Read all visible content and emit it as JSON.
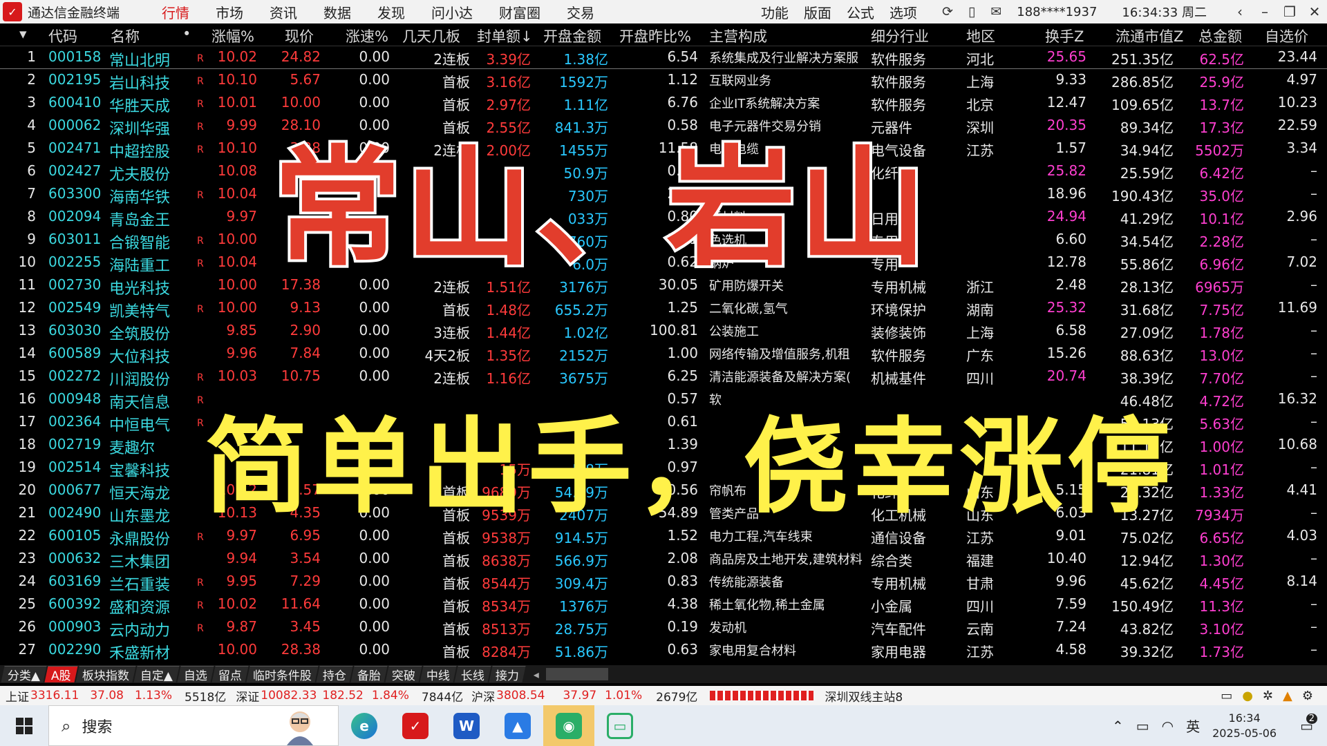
{
  "app": {
    "title": "通达信金融终端",
    "menu": [
      "行情",
      "市场",
      "资讯",
      "数据",
      "发现",
      "问小达",
      "财富圈",
      "交易"
    ],
    "active_menu": "行情",
    "right_menu": [
      "功能",
      "版面",
      "公式",
      "选项"
    ],
    "user": "188****1937",
    "clock": "16:34:33 周二"
  },
  "columns": [
    "代码",
    "名称",
    "涨幅%",
    "现价",
    "涨速%",
    "几天几板",
    "封单额↓",
    "开盘金额",
    "开盘昨比%",
    "主营构成",
    "细分行业",
    "地区",
    "换手Z",
    "流通市值Z",
    "总金额",
    "自选价"
  ],
  "rows": [
    {
      "n": "1",
      "code": "000158",
      "name": "常山北明",
      "f": "R",
      "chg": "10.02",
      "price": "24.82",
      "spd": "0.00",
      "board": "2连板",
      "seal": "3.39亿",
      "open": "1.38亿",
      "ratio": "6.54",
      "biz": "系统集成及行业解决方案服",
      "ind": "软件服务",
      "region": "河北",
      "turn": "25.65",
      "turn_hi": true,
      "mcap": "251.35亿",
      "amt": "62.5亿",
      "sel": "23.44"
    },
    {
      "n": "2",
      "code": "002195",
      "name": "岩山科技",
      "f": "R",
      "chg": "10.10",
      "price": "5.67",
      "spd": "0.00",
      "board": "首板",
      "seal": "3.16亿",
      "open": "1592万",
      "ratio": "1.12",
      "biz": "互联网业务",
      "ind": "软件服务",
      "region": "上海",
      "turn": "9.33",
      "turn_hi": false,
      "mcap": "286.85亿",
      "amt": "25.9亿",
      "sel": "4.97"
    },
    {
      "n": "3",
      "code": "600410",
      "name": "华胜天成",
      "f": "R",
      "chg": "10.01",
      "price": "10.00",
      "spd": "0.00",
      "board": "首板",
      "seal": "2.97亿",
      "open": "1.11亿",
      "ratio": "6.76",
      "biz": "企业IT系统解决方案",
      "ind": "软件服务",
      "region": "北京",
      "turn": "12.47",
      "turn_hi": false,
      "mcap": "109.65亿",
      "amt": "13.7亿",
      "sel": "10.23"
    },
    {
      "n": "4",
      "code": "000062",
      "name": "深圳华强",
      "f": "R",
      "chg": "9.99",
      "price": "28.10",
      "spd": "0.00",
      "board": "首板",
      "seal": "2.55亿",
      "open": "841.3万",
      "ratio": "0.58",
      "biz": "电子元器件交易分销",
      "ind": "元器件",
      "region": "深圳",
      "turn": "20.35",
      "turn_hi": true,
      "mcap": "89.34亿",
      "amt": "17.3亿",
      "sel": "22.59"
    },
    {
      "n": "5",
      "code": "002471",
      "name": "中超控股",
      "f": "R",
      "chg": "10.10",
      "price": "3.38",
      "spd": "0.00",
      "board": "2连板",
      "seal": "2.00亿",
      "open": "1455万",
      "ratio": "11.58",
      "biz": "电力电缆",
      "ind": "电气设备",
      "region": "江苏",
      "turn": "1.57",
      "turn_hi": false,
      "mcap": "34.94亿",
      "amt": "5502万",
      "sel": "3.34"
    },
    {
      "n": "6",
      "code": "002427",
      "name": "尤夫股份",
      "f": "",
      "chg": "10.08",
      "price": "",
      "spd": "",
      "board": "",
      "seal": "",
      "open": "50.9万",
      "ratio": "0.70",
      "biz": "涤纶工业丝",
      "ind": "化纤",
      "region": "",
      "turn": "25.82",
      "turn_hi": true,
      "mcap": "25.59亿",
      "amt": "6.42亿",
      "sel": "–"
    },
    {
      "n": "7",
      "code": "603300",
      "name": "海南华铁",
      "f": "R",
      "chg": "10.04",
      "price": "",
      "spd": "",
      "board": "",
      "seal": "",
      "open": "730万",
      "ratio": "2.36",
      "biz": "高空作业平台",
      "ind": "",
      "region": "",
      "turn": "18.96",
      "turn_hi": false,
      "mcap": "190.43亿",
      "amt": "35.0亿",
      "sel": "–"
    },
    {
      "n": "8",
      "code": "002094",
      "name": "青岛金王",
      "f": "",
      "chg": "9.97",
      "price": "",
      "spd": "",
      "board": "",
      "seal": "",
      "open": "033万",
      "ratio": "0.80",
      "biz": "新材料",
      "ind": "日用",
      "region": "",
      "turn": "24.94",
      "turn_hi": true,
      "mcap": "41.29亿",
      "amt": "10.1亿",
      "sel": "2.96"
    },
    {
      "n": "9",
      "code": "603011",
      "name": "合锻智能",
      "f": "R",
      "chg": "10.00",
      "price": "",
      "spd": "",
      "board": "",
      "seal": "",
      "open": "760万",
      "ratio": "3.61",
      "biz": "色选机",
      "ind": "专用",
      "region": "",
      "turn": "6.60",
      "turn_hi": false,
      "mcap": "34.54亿",
      "amt": "2.28亿",
      "sel": "–"
    },
    {
      "n": "10",
      "code": "002255",
      "name": "海陆重工",
      "f": "R",
      "chg": "10.04",
      "price": "",
      "spd": "",
      "board": "",
      "seal": "",
      "open": "6.0万",
      "ratio": "0.62",
      "biz": "锅炉",
      "ind": "专用",
      "region": "",
      "turn": "12.78",
      "turn_hi": false,
      "mcap": "55.86亿",
      "amt": "6.96亿",
      "sel": "7.02"
    },
    {
      "n": "11",
      "code": "002730",
      "name": "电光科技",
      "f": "",
      "chg": "10.00",
      "price": "17.38",
      "spd": "0.00",
      "board": "2连板",
      "seal": "1.51亿",
      "open": "3176万",
      "ratio": "30.05",
      "biz": "矿用防爆开关",
      "ind": "专用机械",
      "region": "浙江",
      "turn": "2.48",
      "turn_hi": false,
      "mcap": "28.13亿",
      "amt": "6965万",
      "sel": "–"
    },
    {
      "n": "12",
      "code": "002549",
      "name": "凯美特气",
      "f": "R",
      "chg": "10.00",
      "price": "9.13",
      "spd": "0.00",
      "board": "首板",
      "seal": "1.48亿",
      "open": "655.2万",
      "ratio": "1.25",
      "biz": "二氧化碳,氢气",
      "ind": "环境保护",
      "region": "湖南",
      "turn": "25.32",
      "turn_hi": true,
      "mcap": "31.68亿",
      "amt": "7.75亿",
      "sel": "11.69"
    },
    {
      "n": "13",
      "code": "603030",
      "name": "全筑股份",
      "f": "",
      "chg": "9.85",
      "price": "2.90",
      "spd": "0.00",
      "board": "3连板",
      "seal": "1.44亿",
      "open": "1.02亿",
      "ratio": "100.81",
      "biz": "公装施工",
      "ind": "装修装饰",
      "region": "上海",
      "turn": "6.58",
      "turn_hi": false,
      "mcap": "27.09亿",
      "amt": "1.78亿",
      "sel": "–"
    },
    {
      "n": "14",
      "code": "600589",
      "name": "大位科技",
      "f": "",
      "chg": "9.96",
      "price": "7.84",
      "spd": "0.00",
      "board": "4天2板",
      "seal": "1.35亿",
      "open": "2152万",
      "ratio": "1.00",
      "biz": "网络传输及增值服务,机租",
      "ind": "软件服务",
      "region": "广东",
      "turn": "15.26",
      "turn_hi": false,
      "mcap": "88.63亿",
      "amt": "13.0亿",
      "sel": "–"
    },
    {
      "n": "15",
      "code": "002272",
      "name": "川润股份",
      "f": "R",
      "chg": "10.03",
      "price": "10.75",
      "spd": "0.00",
      "board": "2连板",
      "seal": "1.16亿",
      "open": "3675万",
      "ratio": "6.25",
      "biz": "清洁能源装备及解决方案(",
      "ind": "机械基件",
      "region": "四川",
      "turn": "20.74",
      "turn_hi": true,
      "mcap": "38.39亿",
      "amt": "7.70亿",
      "sel": "–"
    },
    {
      "n": "16",
      "code": "000948",
      "name": "南天信息",
      "f": "R",
      "chg": "",
      "price": "",
      "spd": "",
      "board": "",
      "seal": "",
      "open": "",
      "ratio": "0.57",
      "biz": "软",
      "ind": "",
      "region": "",
      "turn": "",
      "turn_hi": false,
      "mcap": "46.48亿",
      "amt": "4.72亿",
      "sel": "16.32"
    },
    {
      "n": "17",
      "code": "002364",
      "name": "中恒电气",
      "f": "R",
      "chg": "",
      "price": "",
      "spd": "",
      "board": "",
      "seal": "",
      "open": "",
      "ratio": "0.61",
      "biz": "",
      "ind": "",
      "region": "",
      "turn": "",
      "turn_hi": false,
      "mcap": "51.13亿",
      "amt": "5.63亿",
      "sel": "–"
    },
    {
      "n": "18",
      "code": "002719",
      "name": "麦趣尔",
      "f": "",
      "chg": "",
      "price": "",
      "spd": "",
      "board": "",
      "seal": "",
      "open": "",
      "ratio": "1.39",
      "biz": "",
      "ind": "",
      "region": "",
      "turn": "",
      "turn_hi": false,
      "mcap": "11.12亿",
      "amt": "1.00亿",
      "sel": "10.68"
    },
    {
      "n": "19",
      "code": "002514",
      "name": "宝馨科技",
      "f": "",
      "chg": "",
      "price": "",
      "spd": "",
      "board": "",
      "seal": "15万",
      "open": "5.8万",
      "ratio": "0.97",
      "biz": "",
      "ind": "",
      "region": "",
      "turn": "",
      "turn_hi": false,
      "mcap": "21.81亿",
      "amt": "1.01亿",
      "sel": "–"
    },
    {
      "n": "20",
      "code": "000677",
      "name": "恒天海龙",
      "f": "",
      "chg": "10.12",
      "price": "4.57",
      "spd": "0.00",
      "board": "首板",
      "seal": "9689万",
      "open": "54.09万",
      "ratio": "0.56",
      "biz": "帘帆布",
      "ind": "化纤",
      "region": "山东",
      "turn": "5.15",
      "turn_hi": false,
      "mcap": "26.32亿",
      "amt": "1.33亿",
      "sel": "4.41"
    },
    {
      "n": "21",
      "code": "002490",
      "name": "山东墨龙",
      "f": "",
      "chg": "10.13",
      "price": "4.35",
      "spd": "0.00",
      "board": "首板",
      "seal": "9539万",
      "open": "2407万",
      "ratio": "54.89",
      "biz": "管类产品",
      "ind": "化工机械",
      "region": "山东",
      "turn": "6.03",
      "turn_hi": false,
      "mcap": "13.27亿",
      "amt": "7934万",
      "sel": "–"
    },
    {
      "n": "22",
      "code": "600105",
      "name": "永鼎股份",
      "f": "R",
      "chg": "9.97",
      "price": "6.95",
      "spd": "0.00",
      "board": "首板",
      "seal": "9538万",
      "open": "914.5万",
      "ratio": "1.52",
      "biz": "电力工程,汽车线束",
      "ind": "通信设备",
      "region": "江苏",
      "turn": "9.01",
      "turn_hi": false,
      "mcap": "75.02亿",
      "amt": "6.65亿",
      "sel": "4.03"
    },
    {
      "n": "23",
      "code": "000632",
      "name": "三木集团",
      "f": "",
      "chg": "9.94",
      "price": "3.54",
      "spd": "0.00",
      "board": "首板",
      "seal": "8638万",
      "open": "566.9万",
      "ratio": "2.08",
      "biz": "商品房及土地开发,建筑材料",
      "ind": "综合类",
      "region": "福建",
      "turn": "10.40",
      "turn_hi": false,
      "mcap": "12.94亿",
      "amt": "1.30亿",
      "sel": "–"
    },
    {
      "n": "24",
      "code": "603169",
      "name": "兰石重装",
      "f": "R",
      "chg": "9.95",
      "price": "7.29",
      "spd": "0.00",
      "board": "首板",
      "seal": "8544万",
      "open": "309.4万",
      "ratio": "0.83",
      "biz": "传统能源装备",
      "ind": "专用机械",
      "region": "甘肃",
      "turn": "9.96",
      "turn_hi": false,
      "mcap": "45.62亿",
      "amt": "4.45亿",
      "sel": "8.14"
    },
    {
      "n": "25",
      "code": "600392",
      "name": "盛和资源",
      "f": "R",
      "chg": "10.02",
      "price": "11.64",
      "spd": "0.00",
      "board": "首板",
      "seal": "8534万",
      "open": "1376万",
      "ratio": "4.38",
      "biz": "稀土氧化物,稀土金属",
      "ind": "小金属",
      "region": "四川",
      "turn": "7.59",
      "turn_hi": false,
      "mcap": "150.49亿",
      "amt": "11.3亿",
      "sel": "–"
    },
    {
      "n": "26",
      "code": "000903",
      "name": "云内动力",
      "f": "R",
      "chg": "9.87",
      "price": "3.45",
      "spd": "0.00",
      "board": "首板",
      "seal": "8513万",
      "open": "28.75万",
      "ratio": "0.19",
      "biz": "发动机",
      "ind": "汽车配件",
      "region": "云南",
      "turn": "7.24",
      "turn_hi": false,
      "mcap": "43.82亿",
      "amt": "3.10亿",
      "sel": "–"
    },
    {
      "n": "27",
      "code": "002290",
      "name": "禾盛新材",
      "f": "",
      "chg": "10.00",
      "price": "28.38",
      "spd": "0.00",
      "board": "首板",
      "seal": "8284万",
      "open": "51.86万",
      "ratio": "0.63",
      "biz": "家电用复合材料",
      "ind": "家用电器",
      "region": "江苏",
      "turn": "4.58",
      "turn_hi": false,
      "mcap": "39.32亿",
      "amt": "1.73亿",
      "sel": "–"
    }
  ],
  "tabs": [
    "分类▲",
    "A股",
    "板块指数",
    "自定▲",
    "自选",
    "留点",
    "临时条件股",
    "持仓",
    "备胎",
    "突破",
    "中线",
    "长线",
    "接力"
  ],
  "active_tab": "A股",
  "status": {
    "sh_label": "上证",
    "sh_value": "3316.11",
    "sh_chg": "37.08",
    "sh_pct": "1.13%",
    "sh_amt": "5518亿",
    "sz_label": "深证",
    "sz_value": "10082.33",
    "sz_chg": "182.52",
    "sz_pct": "1.84%",
    "sz_amt": "7844亿",
    "hs_label": "沪深",
    "hs_value": "3808.54",
    "hs_chg": "37.97",
    "hs_pct": "1.01%",
    "hs_amt": "2679亿",
    "server": "深圳双线主站8"
  },
  "taskbar": {
    "search": "搜索",
    "ime": "英",
    "time": "16:34",
    "date": "2025-05-06",
    "notif": "2"
  },
  "overlay": {
    "top": "常山、岩山",
    "bottom": "简单出手，侥幸涨停"
  }
}
